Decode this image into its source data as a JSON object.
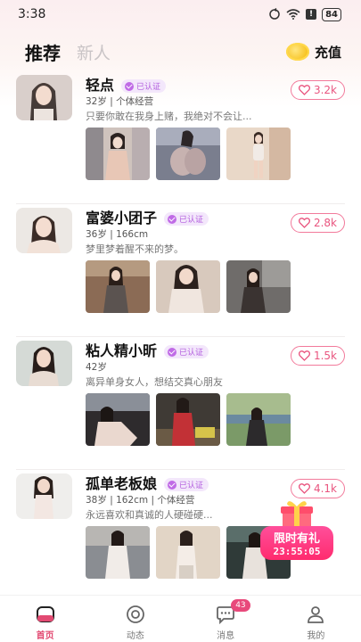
{
  "status_bar": {
    "time": "3:38",
    "battery": "84"
  },
  "header": {
    "tabs": [
      {
        "label": "推荐"
      },
      {
        "label": "新人"
      }
    ],
    "recharge_label": "充值"
  },
  "feed": [
    {
      "name": "轻点",
      "verified_label": "已认证",
      "meta": "32岁 | 个体经营",
      "bio": "只要你敢在我身上赌，我绝对不会让...",
      "likes": "3.2k"
    },
    {
      "name": "富婆小团子",
      "verified_label": "已认证",
      "meta": "36岁 | 166cm",
      "bio": "梦里梦着醒不来的梦。",
      "likes": "2.8k"
    },
    {
      "name": "粘人精小昕",
      "verified_label": "已认证",
      "meta": "42岁",
      "bio": "离异单身女人，想结交真心朋友",
      "likes": "1.5k"
    },
    {
      "name": "孤单老板娘",
      "verified_label": "已认证",
      "meta": "38岁 | 162cm | 个体经营",
      "bio": "永远喜欢和真诚的人硬碰硬...",
      "likes": "4.1k"
    }
  ],
  "promo": {
    "title": "限时有礼",
    "countdown": "23:55:05"
  },
  "bottom_nav": [
    {
      "label": "首页",
      "active": true
    },
    {
      "label": "动态"
    },
    {
      "label": "消息",
      "badge": "43"
    },
    {
      "label": "我的"
    }
  ],
  "colors": {
    "accent": "#e24a72",
    "like": "#e9557f",
    "verified": "#b25cde"
  }
}
